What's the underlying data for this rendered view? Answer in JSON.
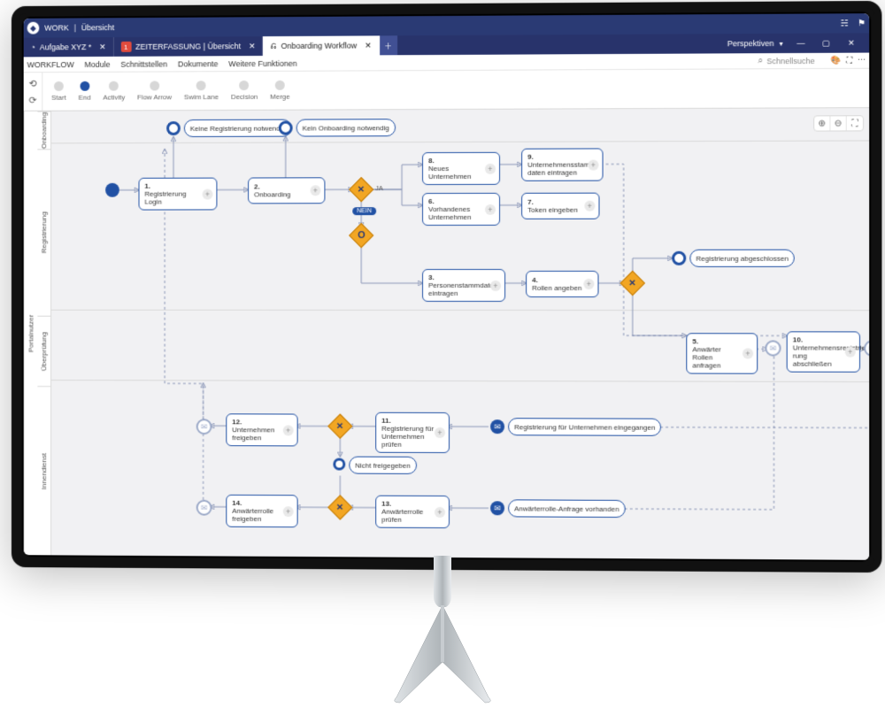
{
  "title": {
    "app": "WORK",
    "page": "Übersicht"
  },
  "tabs": [
    {
      "label": "Aufgabe XYZ *",
      "closable": true
    },
    {
      "label": "ZEITERFASSUNG | Übersicht",
      "badge": "1",
      "closable": true
    },
    {
      "label": "Onboarding Workflow",
      "closable": true,
      "active": true
    }
  ],
  "perspective": "Perspektiven",
  "menu": [
    "WORKFLOW",
    "Module",
    "Schnittstellen",
    "Dokumente",
    "Weitere Funktionen"
  ],
  "search_placeholder": "Schnellsuche",
  "palette": [
    "Start",
    "End",
    "Activity",
    "Flow Arrow",
    "Swim Lane",
    "Decision",
    "Merge"
  ],
  "swimlane_outer": "Portalnutzer",
  "swimlanes": [
    "Onboarding",
    "Registrierung",
    "Überprüfung",
    "Innendienst"
  ],
  "pill_no_reg": "Keine Registrierung notwendig",
  "pill_no_onb": "Kein Onboarding notwendig",
  "pill_reg_done": "Registrierung abgeschlossen",
  "pill_reg_company": "Registrierung für Unternehmen eingegangen",
  "pill_anfrage": "Anwärterrolle-Anfrage vorhanden",
  "pill_not_released": "Nicht freigegeben",
  "gateway_ja": "JA",
  "gateway_nein": "NEIN",
  "tasks": {
    "t1": {
      "num": "1.",
      "label": "Registrierung Login"
    },
    "t2": {
      "num": "2.",
      "label": "Onboarding"
    },
    "t3": {
      "num": "3.",
      "label": "Personenstammdaten eintragen"
    },
    "t4": {
      "num": "4.",
      "label": "Rollen angeben"
    },
    "t5": {
      "num": "5.",
      "label": "Anwärter Rollen anfragen"
    },
    "t6": {
      "num": "6.",
      "label": "Vorhandenes Unternehmen"
    },
    "t7": {
      "num": "7.",
      "label": "Token eingeben"
    },
    "t8": {
      "num": "8.",
      "label": "Neues Unternehmen"
    },
    "t9": {
      "num": "9.",
      "label": "Unternehmensstamm­daten eintragen"
    },
    "t10": {
      "num": "10.",
      "label": "Unternehmensregistrie­rung abschließen"
    },
    "t11": {
      "num": "11.",
      "label": "Registrierung für Unter­nehmen prüfen"
    },
    "t12": {
      "num": "12.",
      "label": "Unternehmen freigeben"
    },
    "t13": {
      "num": "13.",
      "label": "Anwärterrolle prüfen"
    },
    "t14": {
      "num": "14.",
      "label": "Anwärterrolle freigeben"
    }
  }
}
